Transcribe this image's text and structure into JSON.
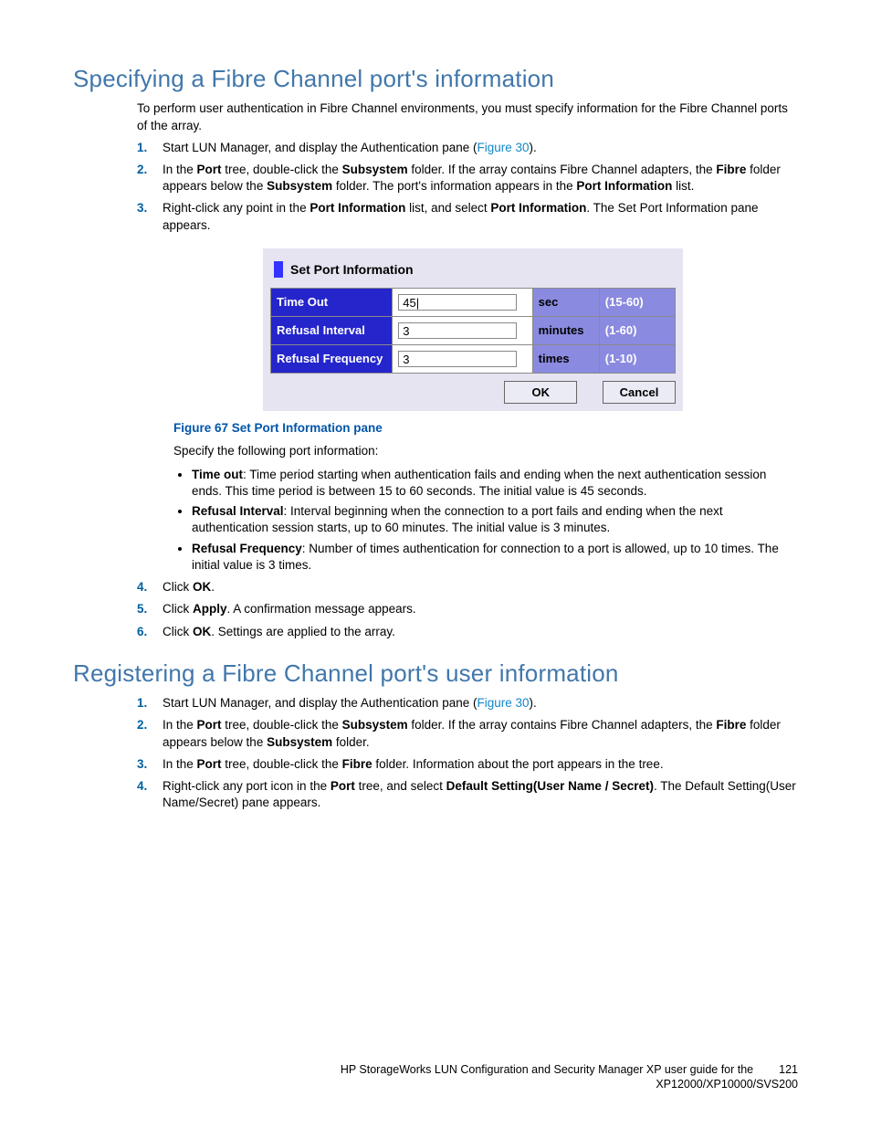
{
  "section1": {
    "title": "Specifying a Fibre Channel port's information",
    "intro": "To perform user authentication in Fibre Channel environments, you must specify information for the Fibre Channel ports of the array.",
    "step1_a": "Start LUN Manager, and display the Authentication pane (",
    "step1_link": "Figure 30",
    "step1_b": ").",
    "step2_a": "In the ",
    "step2_b": "Port",
    "step2_c": " tree, double-click the ",
    "step2_d": "Subsystem",
    "step2_e": " folder. If the array contains Fibre Channel adapters, the ",
    "step2_f": "Fibre",
    "step2_g": " folder appears below the ",
    "step2_h": "Subsystem",
    "step2_i": " folder. The port's information appears in the ",
    "step2_j": "Port Information",
    "step2_k": " list.",
    "step3_a": "Right-click any point in the ",
    "step3_b": "Port Information",
    "step3_c": " list, and select ",
    "step3_d": "Port Information",
    "step3_e": ". The Set Port Information pane appears.",
    "pane": {
      "title": "Set Port Information",
      "rows": [
        {
          "label": "Time Out",
          "value": "45|",
          "unit": "sec",
          "range": "(15-60)"
        },
        {
          "label": "Refusal Interval",
          "value": "3",
          "unit": "minutes",
          "range": "(1-60)"
        },
        {
          "label": "Refusal Frequency",
          "value": "3",
          "unit": "times",
          "range": "(1-10)"
        }
      ],
      "ok": "OK",
      "cancel": "Cancel"
    },
    "figure_caption": "Figure 67 Set Port Information pane",
    "spec_desc": "Specify the following port information:",
    "bullets": {
      "b1_t": "Time out",
      "b1_r": ": Time period starting when authentication fails and ending when the next authentication session ends. This time period is between 15 to 60 seconds. The initial value is 45 seconds.",
      "b2_t": "Refusal Interval",
      "b2_r": ": Interval beginning when the connection to a port fails and ending when the next authentication session starts, up to 60 minutes. The initial value is 3 minutes.",
      "b3_t": "Refusal Frequency",
      "b3_r": ": Number of times authentication for connection to a port is allowed, up to 10 times. The initial value is 3 times."
    },
    "step4_a": "Click ",
    "step4_b": "OK",
    "step4_c": ".",
    "step5_a": "Click ",
    "step5_b": "Apply",
    "step5_c": ". A confirmation message appears.",
    "step6_a": "Click ",
    "step6_b": "OK",
    "step6_c": ". Settings are applied to the array."
  },
  "section2": {
    "title": "Registering a Fibre Channel port's user information",
    "step1_a": "Start LUN Manager, and display the Authentication pane (",
    "step1_link": "Figure 30",
    "step1_b": ").",
    "step2_a": "In the ",
    "step2_b": "Port",
    "step2_c": " tree, double-click the ",
    "step2_d": "Subsystem",
    "step2_e": " folder. If the array contains Fibre Channel adapters, the ",
    "step2_f": "Fibre",
    "step2_g": " folder appears below the ",
    "step2_h": "Subsystem",
    "step2_i": " folder.",
    "step3_a": "In the ",
    "step3_b": "Port",
    "step3_c": " tree, double-click the ",
    "step3_d": "Fibre",
    "step3_e": " folder. Information about the port appears in the tree.",
    "step4_a": "Right-click any port icon in the ",
    "step4_b": "Port",
    "step4_c": " tree, and select ",
    "step4_d": "Default Setting(User Name / Secret)",
    "step4_e": ". The Default Setting(User Name/Secret) pane appears."
  },
  "footer": {
    "line1": "HP StorageWorks LUN Configuration and Security Manager XP user guide for the",
    "line2": "XP12000/XP10000/SVS200",
    "page": "121"
  }
}
